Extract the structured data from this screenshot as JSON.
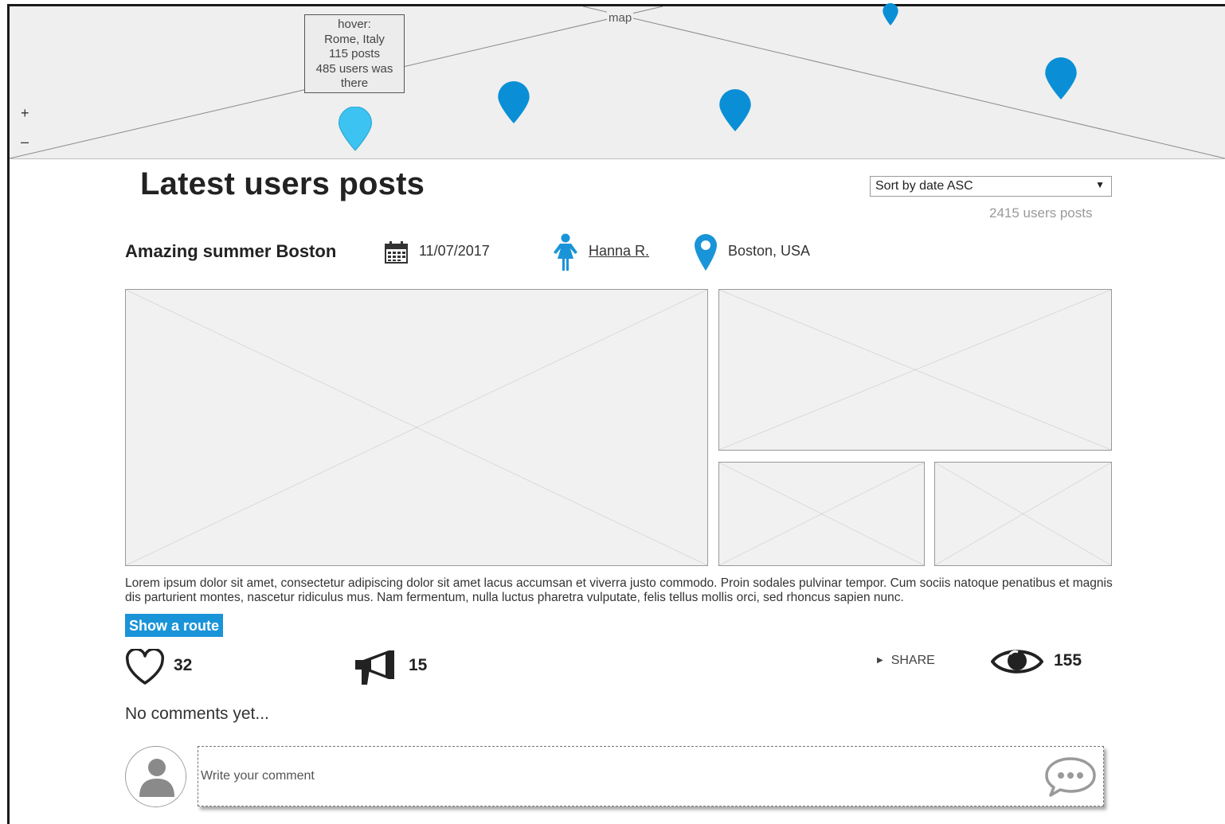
{
  "map": {
    "label": "map",
    "zoom_in": "+",
    "zoom_out": "–",
    "tooltip": {
      "line1": "hover:",
      "line2": "Rome, Italy",
      "line3": "115 posts",
      "line4": "485 users was",
      "line5": "there"
    },
    "pin_color": "#0a8fd6",
    "pin_hover_color": "#3cc3f2"
  },
  "header": {
    "title": "Latest users posts",
    "sort": "Sort by date ASC",
    "sort_arrow": "▼",
    "count": "2415 users posts"
  },
  "post": {
    "title": "Amazing summer Boston",
    "date": "11/07/2017",
    "author": "Hanna R.",
    "location": "Boston, USA",
    "body": "Lorem ipsum dolor sit amet, consectetur adipiscing dolor sit amet lacus accumsan et viverra justo commodo. Proin sodales pulvinar tempor. Cum sociis natoque penatibus et magnis dis parturient montes, nascetur ridiculus mus. Nam fermentum, nulla luctus pharetra vulputate, felis tellus mollis orci, sed rhoncus sapien nunc.",
    "route_button": "Show a route",
    "likes": "32",
    "shares": "15",
    "share_label": "SHARE",
    "views": "155",
    "accent_color": "#1a94d8"
  },
  "comments": {
    "empty_text": "No comments yet...",
    "placeholder": "Write your comment"
  }
}
